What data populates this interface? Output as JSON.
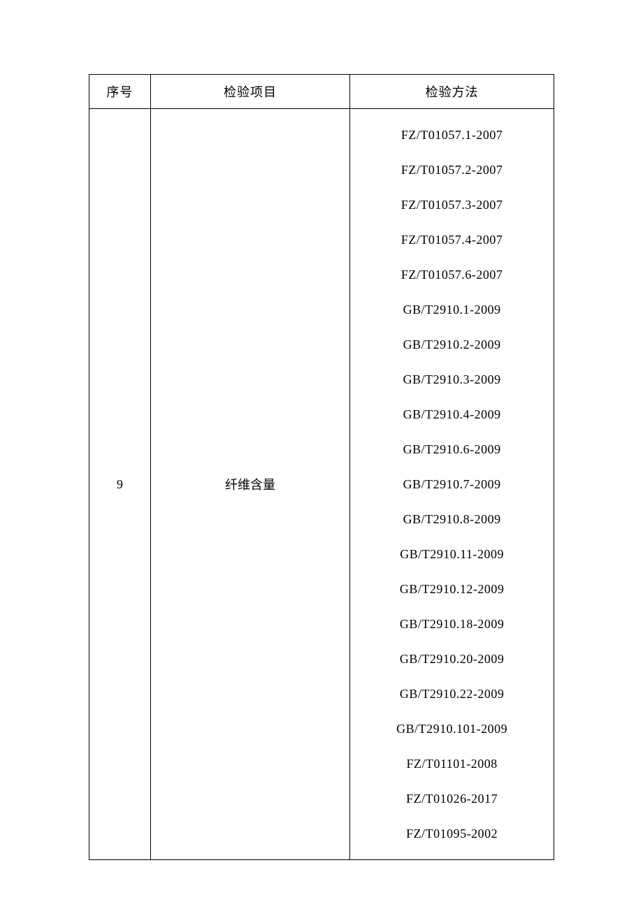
{
  "table": {
    "headers": {
      "seq": "序号",
      "item": "检验项目",
      "method": "检验方法"
    },
    "row": {
      "seq": "9",
      "item": "纤维含量",
      "methods": [
        "FZ/T01057.1-2007",
        "FZ/T01057.2-2007",
        "FZ/T01057.3-2007",
        "FZ/T01057.4-2007",
        "FZ/T01057.6-2007",
        "GB/T2910.1-2009",
        "GB/T2910.2-2009",
        "GB/T2910.3-2009",
        "GB/T2910.4-2009",
        "GB/T2910.6-2009",
        "GB/T2910.7-2009",
        "GB/T2910.8-2009",
        "GB/T2910.11-2009",
        "GB/T2910.12-2009",
        "GB/T2910.18-2009",
        "GB/T2910.20-2009",
        "GB/T2910.22-2009",
        "GB/T2910.101-2009",
        "FZ/T01101-2008",
        "FZ/T01026-2017",
        "FZ/T01095-2002"
      ]
    }
  }
}
